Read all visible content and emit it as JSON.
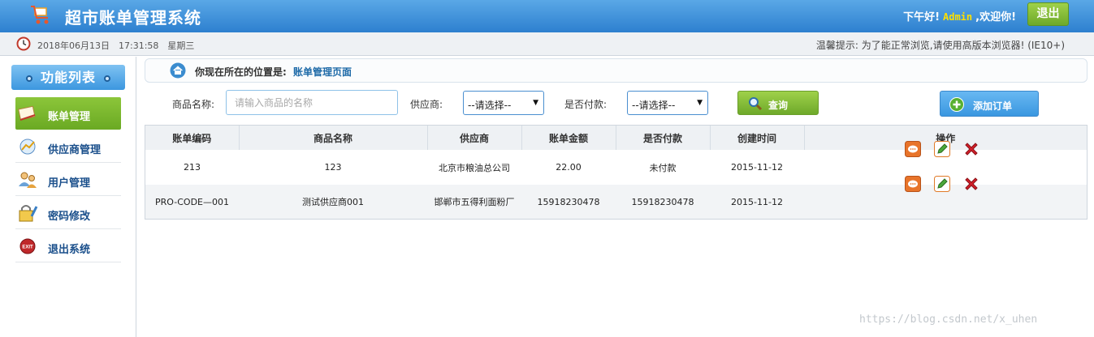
{
  "header": {
    "app_title": "超市账单管理系统",
    "greeting_prefix": "下午好!",
    "user": "Admin",
    "greeting_suffix": ",欢迎你!",
    "logout_label": "退出",
    "accent_color": "#2d80cf"
  },
  "timebar": {
    "date": "2018年06月13日",
    "time": "17:31:58",
    "weekday": "星期三",
    "notice": "温馨提示: 为了能正常浏览,请使用高版本浏览器! (IE10+)"
  },
  "sidebar": {
    "title": "功能列表",
    "items": [
      {
        "label": "账单管理",
        "icon": "bill-icon",
        "active": true
      },
      {
        "label": "供应商管理",
        "icon": "supplier-icon",
        "active": false
      },
      {
        "label": "用户管理",
        "icon": "users-icon",
        "active": false
      },
      {
        "label": "密码修改",
        "icon": "password-icon",
        "active": false
      },
      {
        "label": "退出系统",
        "icon": "exit-icon",
        "active": false
      }
    ]
  },
  "breadcrumb": {
    "prefix": "你现在所在的位置是:",
    "current": "账单管理页面"
  },
  "filters": {
    "product_label": "商品名称:",
    "product_placeholder": "请输入商品的名称",
    "supplier_label": "供应商:",
    "supplier_value": "--请选择--",
    "paid_label": "是否付款:",
    "paid_value": "--请选择--",
    "query_label": "查询",
    "add_label": "添加订单"
  },
  "table": {
    "columns": [
      "账单编码",
      "商品名称",
      "供应商",
      "账单金额",
      "是否付款",
      "创建时间",
      "操作"
    ],
    "rows": [
      [
        "213",
        "123",
        "北京市粮油总公司",
        "22.00",
        "未付款",
        "2015-11-12"
      ],
      [
        "PRO-CODE—001",
        "测试供应商001",
        "邯郸市五得利面粉厂",
        "15918230478",
        "15918230478",
        "2015-11-12"
      ]
    ]
  },
  "watermark": "https://blog.csdn.net/x_uhen"
}
